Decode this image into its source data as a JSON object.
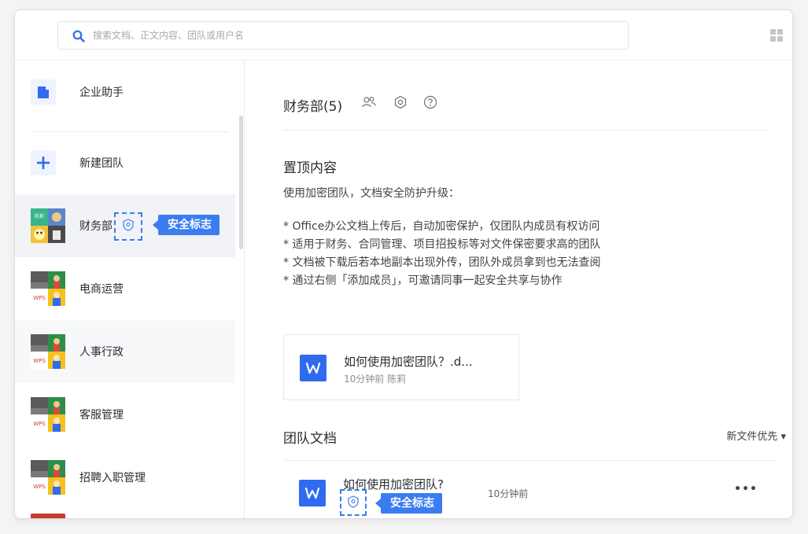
{
  "search": {
    "placeholder": "搜索文档、正文内容、团队或用户名"
  },
  "icons": {
    "search": "search-icon",
    "apps": "apps-grid-icon",
    "members": "members-icon",
    "settings": "gear-icon",
    "help": "help-icon",
    "shield": "shield-icon",
    "document": "wps-word-icon"
  },
  "colors": {
    "accent": "#3b7cf0",
    "doc_blue": "#2f6bef",
    "active_bg": "#f1f3f6"
  },
  "sidebar": {
    "items": [
      {
        "label": "企业助手"
      },
      {
        "label": "新建团队"
      },
      {
        "label": "财务部"
      },
      {
        "label": "电商运营"
      },
      {
        "label": "人事行政"
      },
      {
        "label": "客服管理"
      },
      {
        "label": "招聘入职管理"
      }
    ],
    "avatar_text": "陈莉"
  },
  "annotation": {
    "label": "安全标志"
  },
  "main": {
    "team_title": "财务部(5)",
    "pinned_title": "置顶内容",
    "pinned_intro": "使用加密团队，文档安全防护升级：",
    "pinned_lines": [
      "* Office办公文档上传后，自动加密保护，仅团队内成员有权访问",
      "* 适用于财务、合同管理、项目招投标等对文件保密要求高的团队",
      "* 文档被下载后若本地副本出现外传，团队外成员拿到也无法查阅",
      "* 通过右侧「添加成员」，可邀请同事一起安全共享与协作"
    ],
    "pinned_card": {
      "name": "如何使用加密团队？.d...",
      "meta": "10分钟前 陈莉"
    },
    "docs_title": "团队文档",
    "sort_label": "新文件优先 ▾",
    "docs": [
      {
        "name": "如何使用加密团队?",
        "time": "10分钟前",
        "more": "•••"
      }
    ]
  }
}
